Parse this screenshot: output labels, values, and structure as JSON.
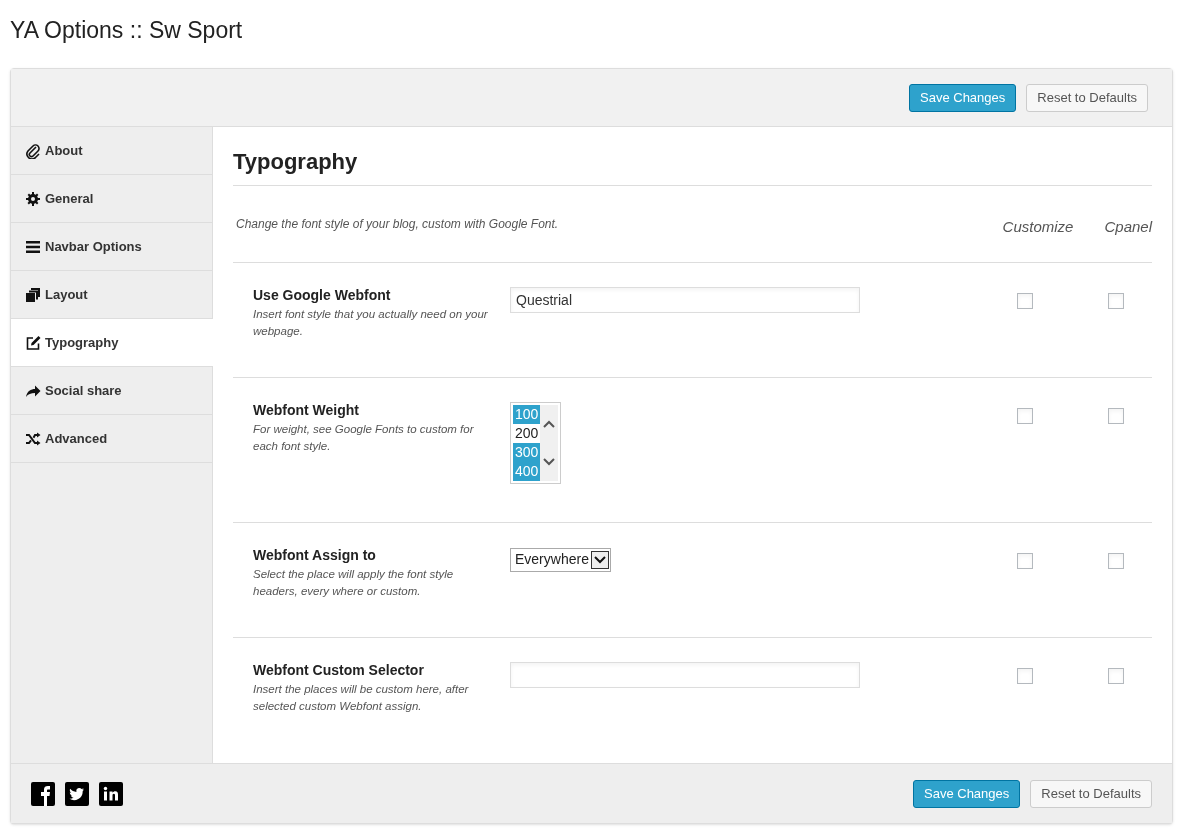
{
  "page_title": "YA Options :: Sw Sport",
  "toolbar": {
    "buttons": [
      {
        "label": "Save Changes",
        "kind": "primary"
      },
      {
        "label": "Reset to Defaults",
        "kind": "secondary"
      }
    ]
  },
  "sidebar": {
    "items": [
      {
        "label": "About",
        "selected": false
      },
      {
        "label": "General",
        "selected": false
      },
      {
        "label": "Navbar Options",
        "selected": false
      },
      {
        "label": "Layout",
        "selected": false
      },
      {
        "label": "Typography",
        "selected": true
      },
      {
        "label": "Social share",
        "selected": false
      },
      {
        "label": "Advanced",
        "selected": false
      }
    ]
  },
  "section": {
    "title": "Typography",
    "description": "Change the font style of your blog, custom with Google Font.",
    "column_headers": [
      "Customize",
      "Cpanel"
    ],
    "rows": [
      {
        "kind": "text",
        "label": "Use Google Webfont",
        "help": "Insert font style that you actually need on your webpage.",
        "value": "Questrial",
        "customize": false,
        "cpanel": false
      },
      {
        "kind": "multiselect",
        "label": "Webfont Weight",
        "help": "For weight, see Google Fonts to custom for each font style.",
        "options": [
          {
            "label": "100",
            "selected": true
          },
          {
            "label": "200",
            "selected": false
          },
          {
            "label": "300",
            "selected": true
          },
          {
            "label": "400",
            "selected": true
          }
        ],
        "customize": false,
        "cpanel": false
      },
      {
        "kind": "select",
        "label": "Webfont Assign to",
        "help": "Select the place will apply the font style headers, every where or custom.",
        "value": "Everywhere",
        "customize": false,
        "cpanel": false
      },
      {
        "kind": "text",
        "label": "Webfont Custom Selector",
        "help": "Insert the places will be custom here, after selected custom Webfont assign.",
        "value": "",
        "customize": false,
        "cpanel": false
      }
    ]
  },
  "footer": {
    "buttons": [
      {
        "label": "Save Changes",
        "kind": "primary"
      },
      {
        "label": "Reset to Defaults",
        "kind": "secondary"
      }
    ]
  }
}
